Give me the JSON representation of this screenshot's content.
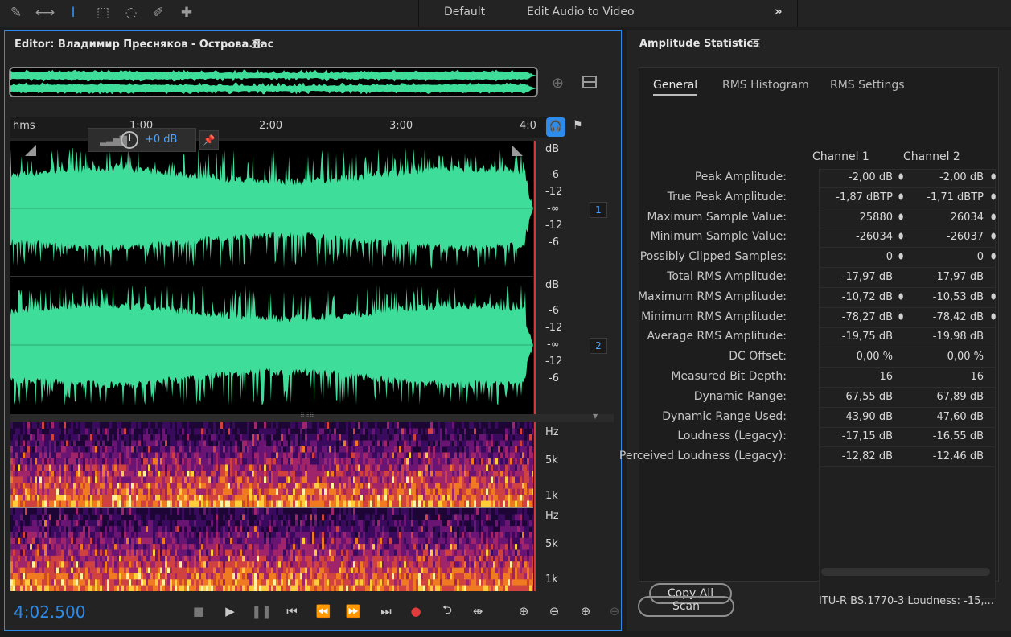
{
  "workspaces": {
    "default": "Default",
    "edit_audio": "Edit Audio to Video",
    "more": "»"
  },
  "editor": {
    "title": "Editor: Владимир Пресняков - Острова.flac",
    "ruler": {
      "unit": "hms",
      "ticks": [
        "1:00",
        "2:00",
        "3:00",
        "4:0"
      ]
    },
    "hud_gain": "+0 dB",
    "db_scale_ch1": [
      "dB",
      "-6",
      "-12",
      "-∞",
      "-12",
      "-6"
    ],
    "db_scale_ch2": [
      "dB",
      "-6",
      "-12",
      "-∞",
      "-12",
      "-6"
    ],
    "channel_1": "1",
    "channel_2": "2",
    "hz_scale_1": [
      "Hz",
      "5k",
      "1k"
    ],
    "hz_scale_2": [
      "Hz",
      "5k",
      "1k"
    ],
    "timecode": "4:02.500",
    "colors": {
      "waveform": "#3fdd9a",
      "playhead": "#d23a3a",
      "accent": "#2d8ceb"
    }
  },
  "stats": {
    "title": "Amplitude Statistics",
    "tabs": [
      "General",
      "RMS Histogram",
      "RMS Settings"
    ],
    "columns": [
      "Channel 1",
      "Channel 2"
    ],
    "rows": [
      {
        "label": "Peak Amplitude:",
        "c1": "-2,00 dB",
        "c2": "-2,00 dB",
        "pin": true
      },
      {
        "label": "True Peak Amplitude:",
        "c1": "-1,87 dBTP",
        "c2": "-1,71 dBTP",
        "pin": true
      },
      {
        "label": "Maximum Sample Value:",
        "c1": "25880",
        "c2": "26034",
        "pin": true
      },
      {
        "label": "Minimum Sample Value:",
        "c1": "-26034",
        "c2": "-26037",
        "pin": true
      },
      {
        "label": "Possibly Clipped Samples:",
        "c1": "0",
        "c2": "0",
        "pin": true
      },
      {
        "label": "Total RMS Amplitude:",
        "c1": "-17,97 dB",
        "c2": "-17,97 dB",
        "pin": false
      },
      {
        "label": "Maximum RMS Amplitude:",
        "c1": "-10,72 dB",
        "c2": "-10,53 dB",
        "pin": true
      },
      {
        "label": "Minimum RMS Amplitude:",
        "c1": "-78,27 dB",
        "c2": "-78,42 dB",
        "pin": true
      },
      {
        "label": "Average RMS Amplitude:",
        "c1": "-19,75 dB",
        "c2": "-19,98 dB",
        "pin": false
      },
      {
        "label": "DC Offset:",
        "c1": "0,00 %",
        "c2": "0,00 %",
        "pin": false
      },
      {
        "label": "Measured Bit Depth:",
        "c1": "16",
        "c2": "16",
        "pin": false
      },
      {
        "label": "Dynamic Range:",
        "c1": "67,55 dB",
        "c2": "67,89 dB",
        "pin": false
      },
      {
        "label": "Dynamic Range Used:",
        "c1": "43,90 dB",
        "c2": "47,60 dB",
        "pin": false
      },
      {
        "label": "Loudness (Legacy):",
        "c1": "-17,15 dB",
        "c2": "-16,55 dB",
        "pin": false
      },
      {
        "label": "Perceived Loudness (Legacy):",
        "c1": "-12,82 dB",
        "c2": "-12,46 dB",
        "pin": false
      }
    ],
    "copy_all": "Copy All",
    "itu": "ITU-R BS.1770-3 Loudness:  -15,...",
    "scan": "Scan"
  }
}
